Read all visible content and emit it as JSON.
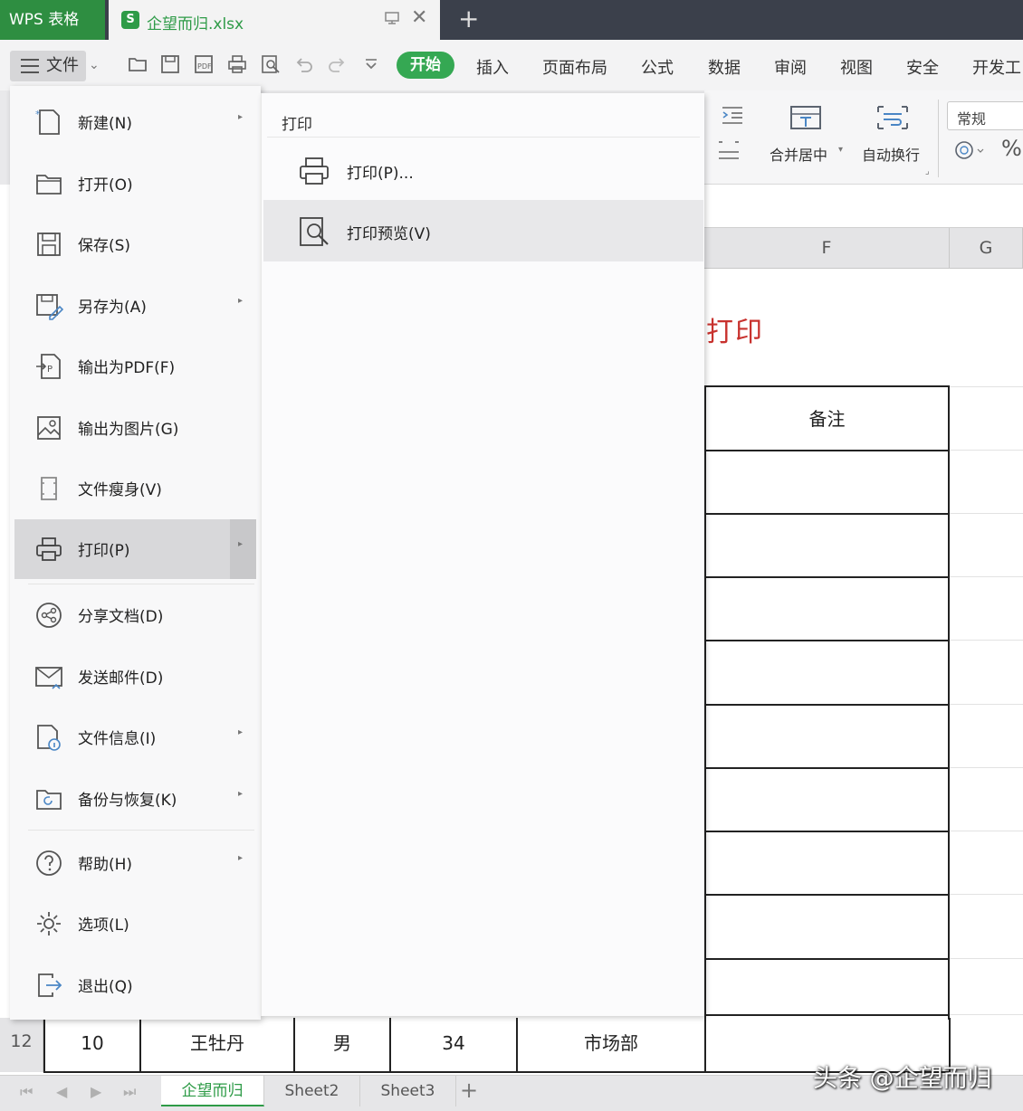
{
  "titlebar": {
    "app_name": "WPS 表格",
    "file_icon_letter": "S",
    "file_name": "企望而归.xlsx",
    "close_glyph": "✕",
    "new_tab_glyph": "+"
  },
  "toolbar": {
    "file_menu_label": "文件",
    "start_tab": "开始",
    "tabs": [
      "插入",
      "页面布局",
      "公式",
      "数据",
      "审阅",
      "视图",
      "安全",
      "开发工"
    ]
  },
  "ribbon": {
    "merge_label": "合并居中",
    "wrap_label": "自动换行",
    "number_format": "常规",
    "percent_glyph": "%"
  },
  "file_menu": {
    "items": [
      {
        "label": "新建(N)",
        "icon": "new-file-icon",
        "submenu": true
      },
      {
        "label": "打开(O)",
        "icon": "folder-icon",
        "submenu": false
      },
      {
        "label": "保存(S)",
        "icon": "save-icon",
        "submenu": false
      },
      {
        "label": "另存为(A)",
        "icon": "save-as-icon",
        "submenu": true
      },
      {
        "label": "输出为PDF(F)",
        "icon": "pdf-export-icon",
        "submenu": false
      },
      {
        "label": "输出为图片(G)",
        "icon": "image-export-icon",
        "submenu": false
      },
      {
        "label": "文件瘦身(V)",
        "icon": "slim-file-icon",
        "submenu": false
      },
      {
        "label": "打印(P)",
        "icon": "printer-icon",
        "submenu": true
      },
      {
        "label": "分享文档(D)",
        "icon": "share-icon",
        "submenu": false
      },
      {
        "label": "发送邮件(D)",
        "icon": "mail-icon",
        "submenu": false
      },
      {
        "label": "文件信息(I)",
        "icon": "file-info-icon",
        "submenu": true
      },
      {
        "label": "备份与恢复(K)",
        "icon": "backup-icon",
        "submenu": true
      },
      {
        "label": "帮助(H)",
        "icon": "help-icon",
        "submenu": true
      },
      {
        "label": "选项(L)",
        "icon": "gear-icon",
        "submenu": false
      },
      {
        "label": "退出(Q)",
        "icon": "exit-icon",
        "submenu": false
      }
    ],
    "submenu_arrow": "▸",
    "highlighted_item": "打印(P)"
  },
  "print_submenu": {
    "title": "打印",
    "items": [
      {
        "label": "打印(P)...",
        "icon": "printer-icon"
      },
      {
        "label": "打印预览(V)",
        "icon": "print-preview-icon"
      }
    ]
  },
  "sheet": {
    "columns": [
      "F",
      "G"
    ],
    "title_fragment": "打印",
    "header_cell": "备注",
    "row12": {
      "row_number": "12",
      "cells": [
        "10",
        "王牡丹",
        "男",
        "34",
        "市场部"
      ]
    }
  },
  "sheet_tabs": {
    "tabs": [
      "企望而归",
      "Sheet2",
      "Sheet3"
    ],
    "active": "企望而归",
    "add_glyph": "+"
  },
  "watermark": "头条 @企望而归",
  "colors": {
    "brand_green": "#2e8e41",
    "start_pill": "#35a853",
    "title_red": "#c8322e",
    "titlebar_bg": "#3b404b"
  }
}
